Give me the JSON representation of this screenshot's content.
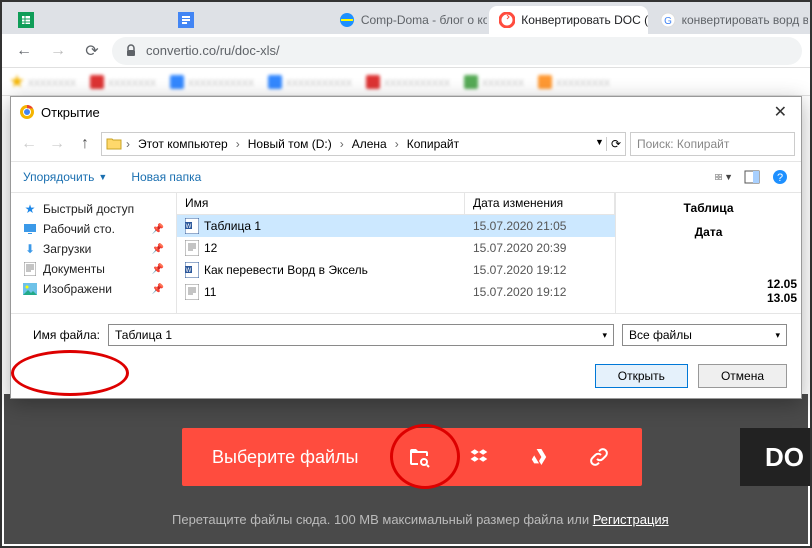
{
  "tabs": [
    {
      "label": "",
      "fav": "sheets"
    },
    {
      "label": "",
      "fav": "docs"
    },
    {
      "label": "Comp-Doma - блог о компьюте",
      "fav": "ie"
    },
    {
      "label": "Конвертировать DOC (WORD) в",
      "fav": "convertio",
      "active": true
    },
    {
      "label": "конвертировать ворд в эксель",
      "fav": "google"
    }
  ],
  "url": "convertio.co/ru/doc-xls/",
  "dialog": {
    "title": "Открытие",
    "breadcrumb": [
      "Этот компьютер",
      "Новый том (D:)",
      "Алена",
      "Копирайт"
    ],
    "search_placeholder": "Поиск: Копирайт",
    "toolbar": {
      "organize": "Упорядочить",
      "newfolder": "Новая папка"
    },
    "columns": {
      "name": "Имя",
      "date": "Дата изменения"
    },
    "sidebar": [
      {
        "icon": "star",
        "label": "Быстрый доступ"
      },
      {
        "icon": "desktop",
        "label": "Рабочий сто.",
        "pin": true
      },
      {
        "icon": "down",
        "label": "Загрузки",
        "pin": true
      },
      {
        "icon": "doc",
        "label": "Документы",
        "pin": true
      },
      {
        "icon": "img",
        "label": "Изображени",
        "pin": true
      }
    ],
    "files": [
      {
        "icon": "word",
        "name": "Таблица 1",
        "date": "15.07.2020 21:05",
        "selected": true
      },
      {
        "icon": "txt",
        "name": "12",
        "date": "15.07.2020 20:39"
      },
      {
        "icon": "word",
        "name": "Как перевести Ворд в Эксель",
        "date": "15.07.2020 19:12"
      },
      {
        "icon": "txt",
        "name": "11",
        "date": "15.07.2020 19:12"
      }
    ],
    "preview": {
      "head": "Таблица",
      "label": "Дата",
      "d1": "12.05",
      "d2": "13.05"
    },
    "filename_label": "Имя файла:",
    "filename_value": "Таблица 1",
    "filetype": "Все файлы",
    "open": "Открыть",
    "cancel": "Отмена"
  },
  "page": {
    "select_label": "Выберите файлы",
    "do": "DO",
    "hint_pre": "Перетащите файлы сюда. 100 MB максимальный размер файла или ",
    "hint_link": "Регистрация"
  }
}
